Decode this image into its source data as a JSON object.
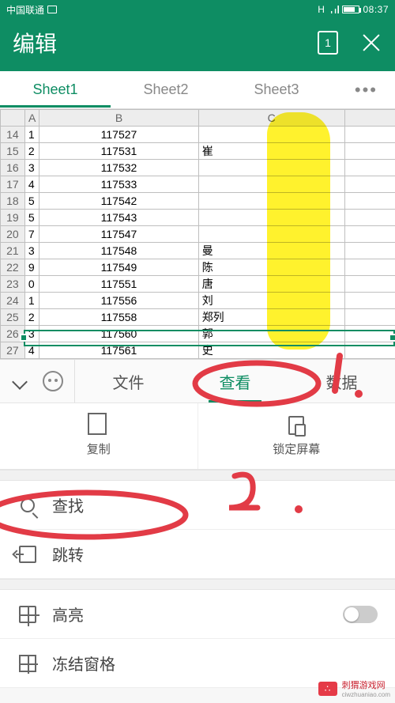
{
  "status": {
    "carrier": "中国联通",
    "time": "08:37",
    "signal_label": "H"
  },
  "header": {
    "title": "编辑",
    "doc_badge": "1"
  },
  "sheet_tabs": {
    "items": [
      "Sheet1",
      "Sheet2",
      "Sheet3"
    ],
    "active": 0,
    "more": "•••"
  },
  "grid": {
    "col_headers": [
      "",
      "B",
      "C",
      ""
    ],
    "rows": [
      {
        "n": 14,
        "a": "1",
        "b": "117527",
        "c": ""
      },
      {
        "n": 15,
        "a": "2",
        "b": "117531",
        "c": "崔"
      },
      {
        "n": 16,
        "a": "3",
        "b": "117532",
        "c": ""
      },
      {
        "n": 17,
        "a": "4",
        "b": "117533",
        "c": ""
      },
      {
        "n": 18,
        "a": "5",
        "b": "117542",
        "c": ""
      },
      {
        "n": 19,
        "a": "5",
        "b": "117543",
        "c": ""
      },
      {
        "n": 20,
        "a": "7",
        "b": "117547",
        "c": ""
      },
      {
        "n": 21,
        "a": "3",
        "b": "117548",
        "c": "曼"
      },
      {
        "n": 22,
        "a": "9",
        "b": "117549",
        "c": "陈"
      },
      {
        "n": 23,
        "a": "0",
        "b": "117551",
        "c": "唐"
      },
      {
        "n": 24,
        "a": "1",
        "b": "117556",
        "c": "刘"
      },
      {
        "n": 25,
        "a": "2",
        "b": "117558",
        "c": "郑列"
      },
      {
        "n": 26,
        "a": "3",
        "b": "117560",
        "c": "郭"
      },
      {
        "n": 27,
        "a": "4",
        "b": "117561",
        "c": "史"
      }
    ],
    "selected_row": 26
  },
  "tool_tabs": {
    "items": [
      "文件",
      "查看",
      "数据"
    ],
    "active": 1
  },
  "actions": {
    "copy": "复制",
    "lock": "锁定屏幕"
  },
  "menu": {
    "search": "查找",
    "jump": "跳转",
    "highlight": "高亮",
    "freeze": "冻结窗格"
  },
  "watermark": {
    "name": "刺猬游戏网",
    "url": "ciwzhuaniao.com"
  }
}
